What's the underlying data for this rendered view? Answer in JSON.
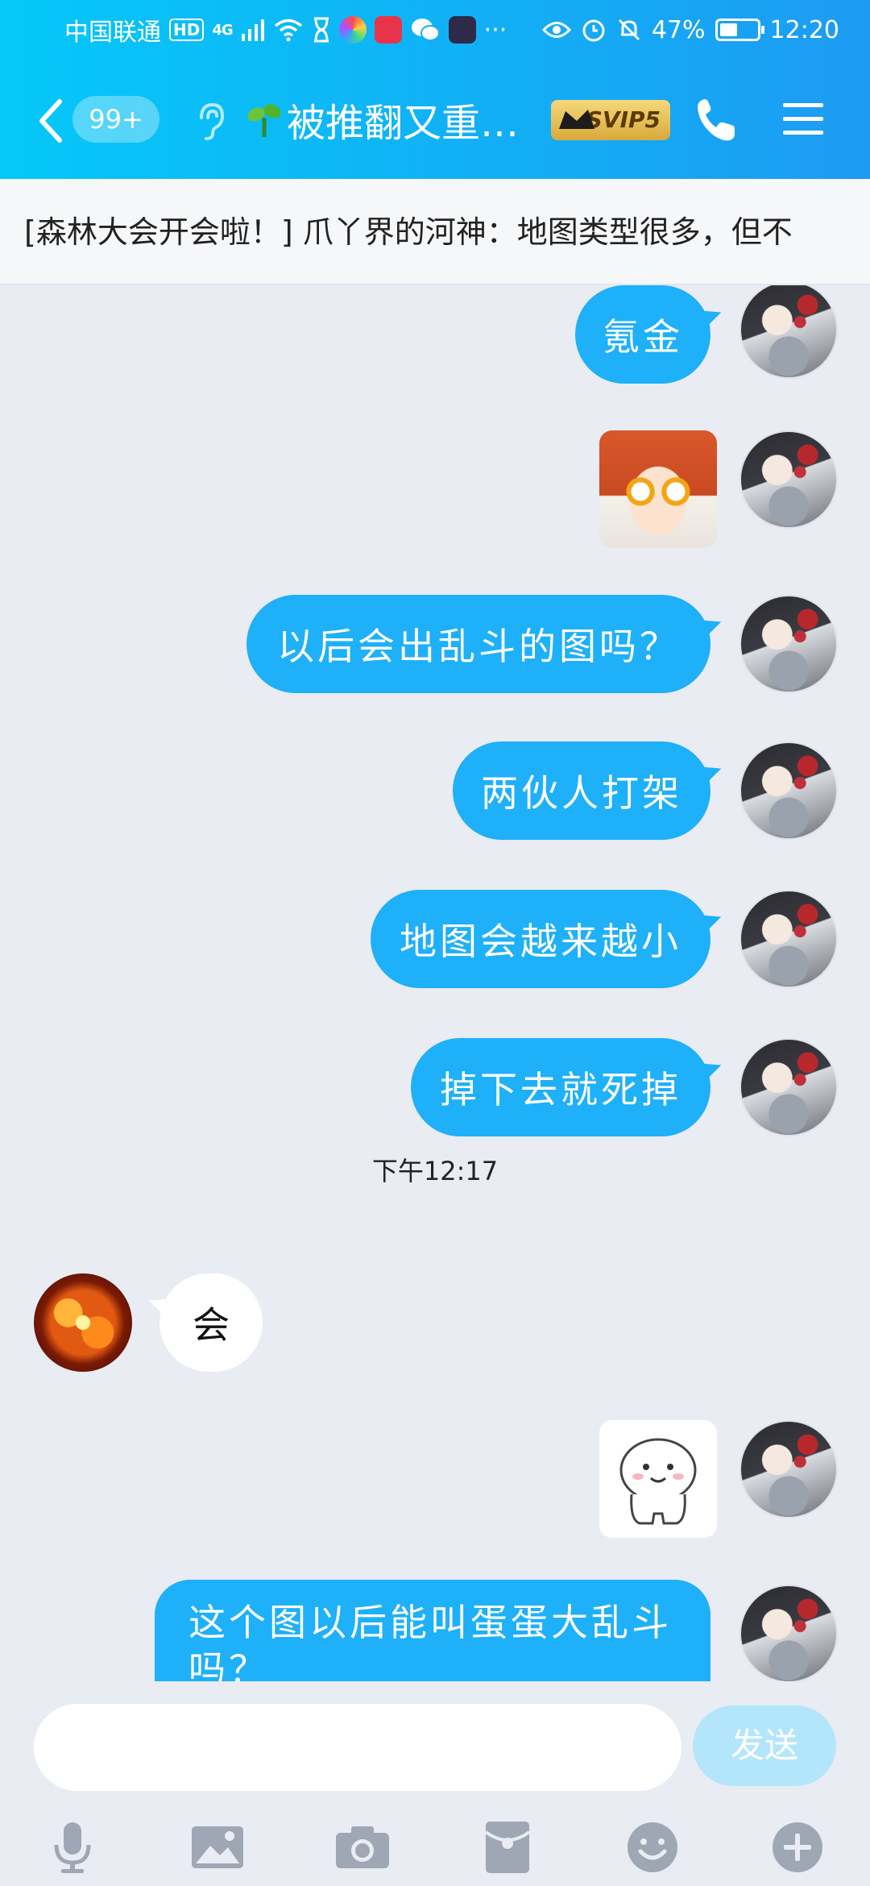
{
  "status_bar": {
    "carrier": "中国联通",
    "hd": "HD",
    "network": "4G",
    "battery": "47%",
    "battery_level": 0.47,
    "time": "12:20",
    "more": "···"
  },
  "header": {
    "unread": "99+",
    "title": "被推翻又重…",
    "svip": "SVIP5"
  },
  "announcement": "[森林大会开会啦！] 爪丫界的河神：地图类型很多，但不",
  "messages": [
    {
      "side": "me",
      "type": "text",
      "text": "氪金"
    },
    {
      "side": "me",
      "type": "sticker",
      "sticker": "crying-girl-sticker"
    },
    {
      "side": "me",
      "type": "text",
      "text": "以后会出乱斗的图吗？"
    },
    {
      "side": "me",
      "type": "text",
      "text": "两伙人打架"
    },
    {
      "side": "me",
      "type": "text",
      "text": "地图会越来越小"
    },
    {
      "side": "me",
      "type": "text",
      "text": "掉下去就死掉"
    },
    {
      "type": "timestamp",
      "text": "下午12:17"
    },
    {
      "side": "other",
      "type": "text",
      "text": "会"
    },
    {
      "side": "me",
      "type": "sticker",
      "sticker": "smiling-blob-sticker"
    },
    {
      "side": "me",
      "type": "text",
      "text": "这个图以后能叫蛋蛋大乱斗吗？"
    }
  ],
  "input": {
    "placeholder": "",
    "send_label": "发送"
  },
  "toolbar": [
    "microphone-icon",
    "image-icon",
    "camera-icon",
    "red-packet-icon",
    "emoji-icon",
    "plus-icon"
  ],
  "colors": {
    "header_start": "#05c8f8",
    "header_end": "#1d9bf3",
    "bubble_me": "#1eb0f8",
    "bubble_other": "#ffffff",
    "background": "#e9ecf3",
    "send_button": "#b4e6fb",
    "toolbar_icon": "#9fa6b4"
  }
}
